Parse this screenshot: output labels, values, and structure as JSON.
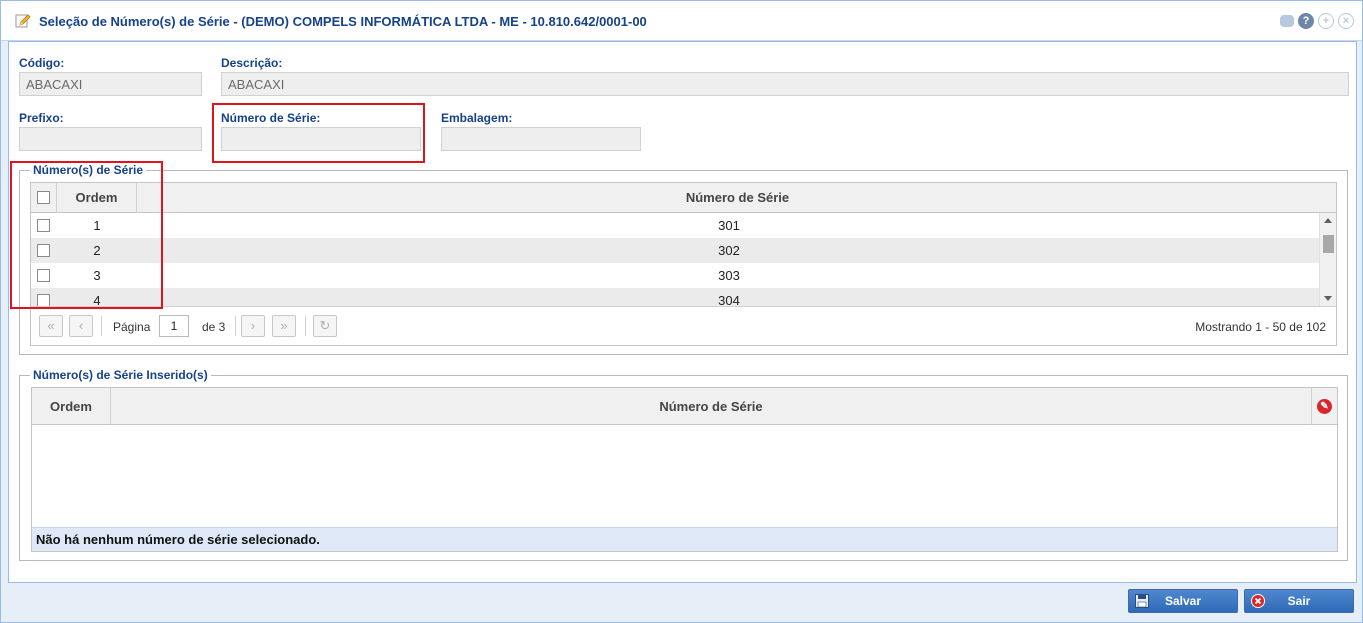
{
  "window": {
    "title": "Seleção de Número(s) de Série - (DEMO) COMPELS INFORMÁTICA LTDA - ME - 10.810.642/0001-00"
  },
  "form": {
    "codigo_label": "Código:",
    "codigo_value": "ABACAXI",
    "descricao_label": "Descrição:",
    "descricao_value": "ABACAXI",
    "prefixo_label": "Prefixo:",
    "prefixo_value": "",
    "numero_serie_label": "Número de Série:",
    "numero_serie_value": "",
    "embalagem_label": "Embalagem:",
    "embalagem_value": ""
  },
  "serials": {
    "legend": "Número(s) de Série",
    "col_ordem": "Ordem",
    "col_numero": "Número de Série",
    "rows": [
      {
        "ordem": "1",
        "numero": "301"
      },
      {
        "ordem": "2",
        "numero": "302"
      },
      {
        "ordem": "3",
        "numero": "303"
      },
      {
        "ordem": "4",
        "numero": "304"
      }
    ],
    "pager": {
      "page_label": "Página",
      "page_value": "1",
      "of_label": "de 3",
      "showing": "Mostrando 1 - 50 de 102"
    }
  },
  "inserted": {
    "legend": "Número(s) de Série Inserido(s)",
    "col_ordem": "Ordem",
    "col_numero": "Número de Série",
    "empty_message": "Não há nenhum número de série selecionado."
  },
  "buttons": {
    "save": "Salvar",
    "exit": "Sair"
  },
  "colors": {
    "title": "#15428b",
    "highlight": "#e0141e",
    "button": "#2f6ab8"
  }
}
